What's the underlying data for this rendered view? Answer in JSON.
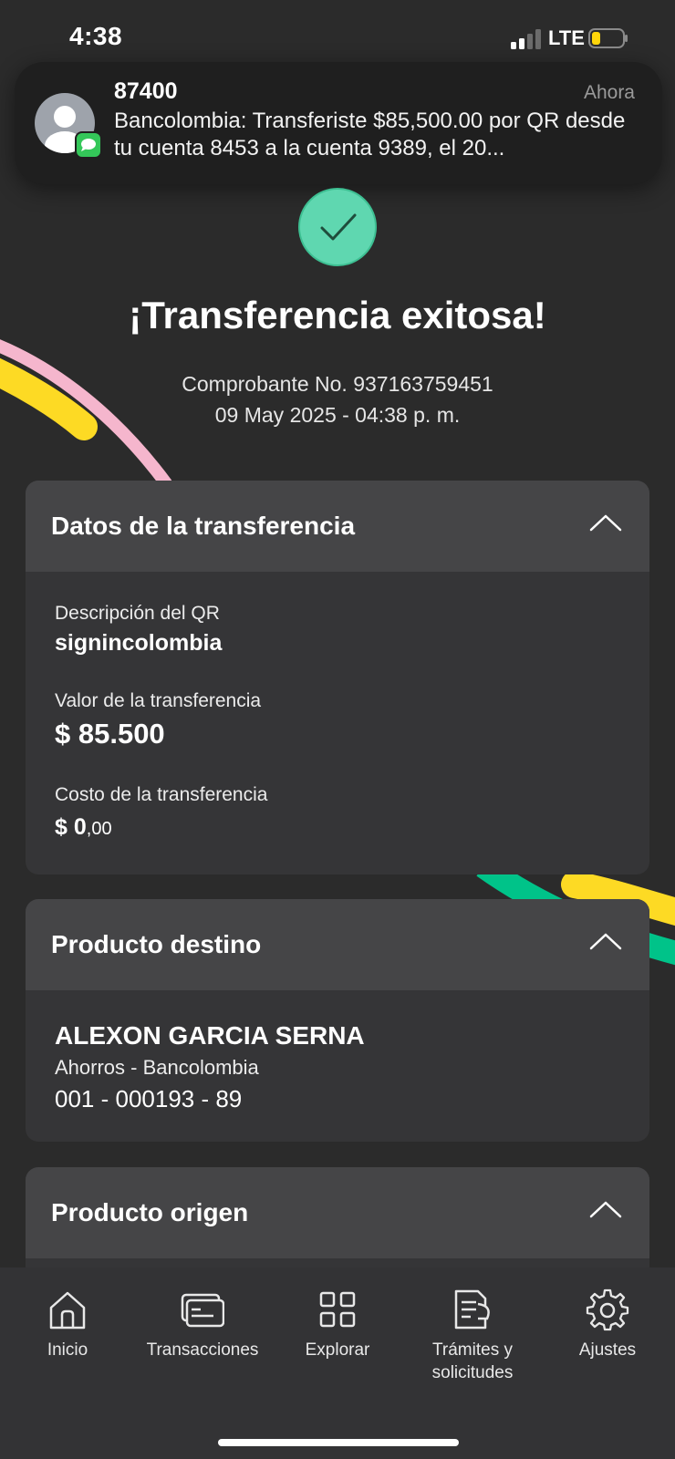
{
  "status_bar": {
    "time": "4:38",
    "network": "LTE"
  },
  "notification": {
    "sender": "87400",
    "time": "Ahora",
    "body": "Bancolombia: Transferiste $85,500.00 por QR desde tu cuenta 8453 a la cuenta 9389, el 20..."
  },
  "header": {
    "title": "¡Transferencia exitosa!",
    "receipt": "Comprobante No. 937163759451",
    "datetime": "09 May 2025 - 04:38 p. m."
  },
  "transfer_card": {
    "title": "Datos de la transferencia",
    "desc_label": "Descripción del QR",
    "desc_value": "signincolombia",
    "amount_label": "Valor de la transferencia",
    "amount_value": "$ 85.500",
    "cost_label": "Costo de la transferencia",
    "cost_whole": "$ 0",
    "cost_cents": ",00"
  },
  "destination_card": {
    "title": "Producto destino",
    "name": "ALEXON GARCIA SERNA",
    "account_type": "Ahorros - Bancolombia",
    "account_number": "001 - 000193 - 89"
  },
  "origin_card": {
    "title": "Producto origen"
  },
  "nav": [
    {
      "label": "Inicio",
      "icon": "home-icon"
    },
    {
      "label": "Transacciones",
      "icon": "card-icon"
    },
    {
      "label": "Explorar",
      "icon": "grid-icon"
    },
    {
      "label": "Trámites y solicitudes",
      "icon": "document-icon"
    },
    {
      "label": "Ajustes",
      "icon": "gear-icon"
    }
  ],
  "colors": {
    "background": "#2b2b2b",
    "card": "#353537",
    "card_header": "#454547",
    "success_green": "#5fd7b0",
    "ribbon_yellow": "#fdda24",
    "ribbon_pink": "#f5b6cd",
    "ribbon_green": "#00c389"
  }
}
